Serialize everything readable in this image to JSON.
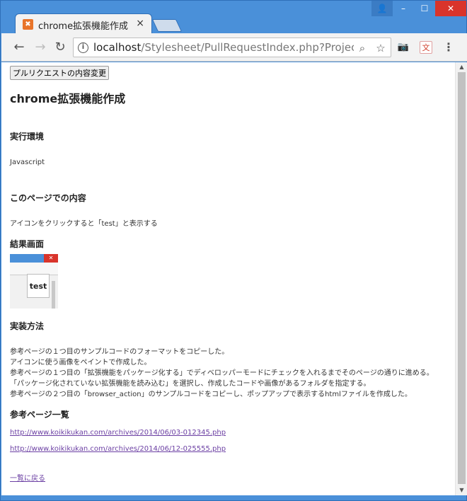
{
  "tab": {
    "title": "chrome拡張機能作成",
    "close_glyph": "×",
    "favicon_glyph": "✖"
  },
  "window_controls": {
    "user": "👤",
    "minimize": "–",
    "maximize": "☐",
    "close": "✕"
  },
  "toolbar": {
    "back": "←",
    "forward": "→",
    "reload": "↻",
    "info": "i",
    "url_host": "localhost",
    "url_path": "/Stylesheet/PullRequestIndex.php?ProjectI…",
    "zoom": "⌕",
    "star": "☆",
    "camera": "📷",
    "translate": "文",
    "menu": "⋮"
  },
  "page": {
    "change_button": "プルリクエストの内容変更",
    "title": "chrome拡張機能作成",
    "env_heading": "実行環境",
    "env_value": "Javascript",
    "content_heading": "このページでの内容",
    "content_value": "アイコンをクリックすると「test」と表示する",
    "result_heading": "結果画面",
    "result_popup_text": "test",
    "impl_heading": "実装方法",
    "impl_lines": [
      "参考ページの１つ目のサンプルコードのフォーマットをコピーした。",
      "アイコンに使う画像をペイントで作成した。",
      "参考ページの１つ目の「拡張機能をパッケージ化する」でディベロッパーモードにチェックを入れるまでそのページの通りに進める。",
      "「パッケージ化されていない拡張機能を読み込む」を選択し、作成したコードや画像があるフォルダを指定する。",
      "参考ページの２つ目の「browser_action」のサンプルコードをコピーし、ポップアップで表示するhtmlファイルを作成した。"
    ],
    "ref_heading": "参考ページ一覧",
    "ref_links": [
      "http://www.koikikukan.com/archives/2014/06/03-012345.php",
      "http://www.koikikukan.com/archives/2014/06/12-025555.php"
    ],
    "back_link": "一覧に戻る"
  },
  "scrollbar": {
    "up": "▲",
    "down": "▼"
  }
}
